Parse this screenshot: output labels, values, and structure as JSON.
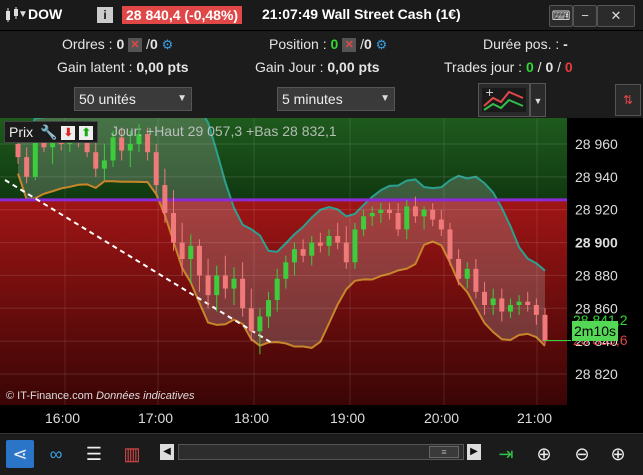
{
  "header": {
    "symbol": "DOW",
    "price_change": "28 840,4 (-0,48%)",
    "title": "21:07:49 Wall Street Cash (1€)"
  },
  "info": {
    "ordres_label": "Ordres :",
    "ordres_value": "0",
    "ordres_slash": "/",
    "ordres_value2": "0",
    "position_label": "Position :",
    "position_value": "0",
    "position_slash": "/",
    "position_value2": "0",
    "duree_label": "Durée pos. :",
    "duree_value": "-",
    "gain_latent_label": "Gain latent :",
    "gain_latent_value": "0,00 pts",
    "gain_jour_label": "Gain Jour :",
    "gain_jour_value": "0,00 pts",
    "trades_label": "Trades jour :",
    "trades_v1": "0",
    "trades_v2": "0",
    "trades_v3": "0",
    "trades_sep": "/"
  },
  "controls": {
    "units": "50 unités",
    "timeframe": "5 minutes"
  },
  "chart_overlay": {
    "prix_label": "Prix",
    "hilo_text": "Jour: +Haut 29 057,3 +Bas 28 832,1",
    "copyright": "© IT-Finance.com",
    "disclaimer": "Données indicatives",
    "timer": "2m10s",
    "price_tag1": "28 841,2",
    "price_tag2": "28 839,6"
  },
  "chart_data": {
    "type": "candlestick",
    "x_ticks": [
      "16:00",
      "17:00",
      "18:00",
      "19:00",
      "20:00",
      "21:00"
    ],
    "y_ticks": [
      "28 960",
      "28 940",
      "28 920",
      "28 900",
      "28 880",
      "28 860",
      "28 840",
      "28 820"
    ],
    "ylim": [
      28810,
      28972
    ],
    "current_price": 28840.4,
    "horizontal_line": 28926,
    "candles": [
      [
        28960,
        28968,
        28948,
        28952
      ],
      [
        28952,
        28958,
        28936,
        28940
      ],
      [
        28940,
        28966,
        28938,
        28962
      ],
      [
        28962,
        28970,
        28955,
        28958
      ],
      [
        28958,
        28968,
        28948,
        28965
      ],
      [
        28965,
        28970,
        28956,
        28960
      ],
      [
        28960,
        28972,
        28955,
        28968
      ],
      [
        28968,
        28972,
        28958,
        28962
      ],
      [
        28962,
        28970,
        28952,
        28955
      ],
      [
        28955,
        28965,
        28940,
        28945
      ],
      [
        28945,
        28960,
        28938,
        28950
      ],
      [
        28950,
        28968,
        28946,
        28964
      ],
      [
        28964,
        28970,
        28950,
        28956
      ],
      [
        28956,
        28968,
        28946,
        28960
      ],
      [
        28960,
        28972,
        28955,
        28966
      ],
      [
        28966,
        28970,
        28950,
        28955
      ],
      [
        28955,
        28960,
        28930,
        28935
      ],
      [
        28935,
        28945,
        28912,
        28918
      ],
      [
        28918,
        28932,
        28895,
        28900
      ],
      [
        28900,
        28912,
        28880,
        28890
      ],
      [
        28890,
        28905,
        28875,
        28898
      ],
      [
        28898,
        28902,
        28870,
        28880
      ],
      [
        28880,
        28890,
        28860,
        28868
      ],
      [
        28868,
        28886,
        28858,
        28880
      ],
      [
        28880,
        28892,
        28866,
        28872
      ],
      [
        28872,
        28885,
        28862,
        28878
      ],
      [
        28878,
        28888,
        28855,
        28860
      ],
      [
        28860,
        28872,
        28840,
        28846
      ],
      [
        28846,
        28860,
        28832,
        28855
      ],
      [
        28855,
        28870,
        28848,
        28865
      ],
      [
        28865,
        28884,
        28858,
        28878
      ],
      [
        28878,
        28892,
        28872,
        28888
      ],
      [
        28888,
        28900,
        28880,
        28896
      ],
      [
        28896,
        28902,
        28888,
        28892
      ],
      [
        28892,
        28904,
        28886,
        28900
      ],
      [
        28900,
        28906,
        28894,
        28898
      ],
      [
        28898,
        28908,
        28892,
        28904
      ],
      [
        28904,
        28912,
        28896,
        28900
      ],
      [
        28900,
        28910,
        28884,
        28888
      ],
      [
        28888,
        28912,
        28884,
        28908
      ],
      [
        28908,
        28920,
        28904,
        28916
      ],
      [
        28916,
        28922,
        28910,
        28918
      ],
      [
        28918,
        28924,
        28912,
        28920
      ],
      [
        28920,
        28924,
        28914,
        28918
      ],
      [
        28918,
        28924,
        28904,
        28908
      ],
      [
        28908,
        28926,
        28902,
        28922
      ],
      [
        28922,
        28928,
        28912,
        28916
      ],
      [
        28916,
        28922,
        28908,
        28920
      ],
      [
        28920,
        28924,
        28910,
        28914
      ],
      [
        28914,
        28920,
        28904,
        28908
      ],
      [
        28908,
        28912,
        28886,
        28890
      ],
      [
        28890,
        28896,
        28874,
        28878
      ],
      [
        28878,
        28888,
        28872,
        28884
      ],
      [
        28884,
        28890,
        28866,
        28870
      ],
      [
        28870,
        28876,
        28856,
        28862
      ],
      [
        28862,
        28872,
        28856,
        28866
      ],
      [
        28866,
        28872,
        28852,
        28858
      ],
      [
        28858,
        28866,
        28854,
        28862
      ],
      [
        28862,
        28868,
        28856,
        28864
      ],
      [
        28864,
        28870,
        28858,
        28862
      ],
      [
        28862,
        28866,
        28850,
        28856
      ],
      [
        28856,
        28860,
        28838,
        28840
      ]
    ]
  },
  "toolbar_icons": [
    "share-icon",
    "link-icon",
    "chart-list-icon",
    "indicator-icon",
    "scroll-left-icon",
    "scroll-right-icon",
    "auto-fit-icon",
    "zoom-fit-icon",
    "zoom-out-icon",
    "zoom-in-icon"
  ]
}
